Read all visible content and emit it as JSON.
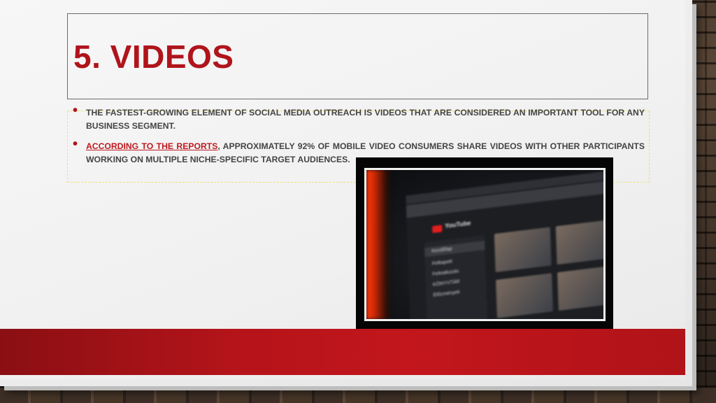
{
  "slide": {
    "title": "5. VIDEOS",
    "bullets": [
      {
        "prefix": "",
        "link": "",
        "text": "THE FASTEST-GROWING ELEMENT OF SOCIAL MEDIA OUTREACH IS VIDEOS THAT ARE CONSIDERED AN IMPORTANT TOOL FOR ANY BUSINESS SEGMENT."
      },
      {
        "prefix": "",
        "link": "ACCORDING TO THE REPORTS",
        "text": ", APPROXIMATELY 92% OF MOBILE VIDEO CONSUMERS SHARE VIDEOS WITH OTHER PARTICIPANTS WORKING ON MULTIPLE NICHE-SPECIFIC TARGET AUDIENCES."
      }
    ],
    "bullet_glyph": "•"
  },
  "photo": {
    "browser_menu": "Safari  Fájl  Szerkesztés  Nézet",
    "logo_text": "YouTube",
    "logo_suffix": "HU",
    "sidebar_items": [
      "Kezdőlap",
      "Felkapott",
      "Feliratkozás",
      "KÖNYVTÁR",
      "Előzmények"
    ]
  },
  "colors": {
    "accent": "#b0141b",
    "band": "#b5141a",
    "body_text": "#444444"
  }
}
